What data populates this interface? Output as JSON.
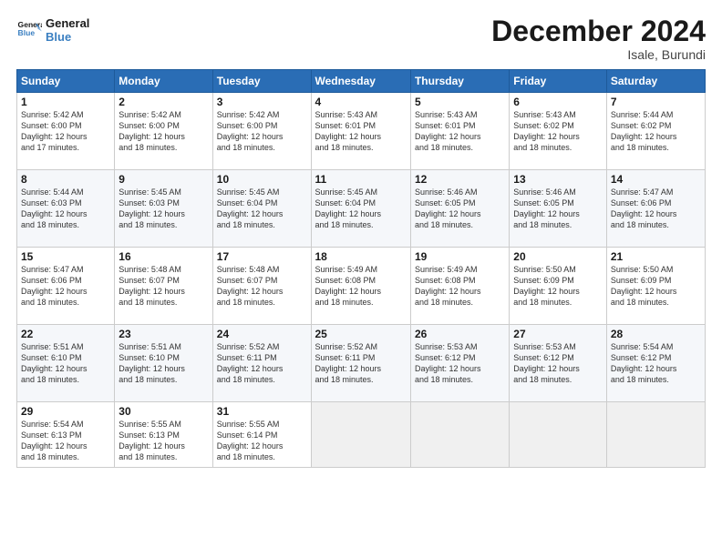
{
  "logo": {
    "line1": "General",
    "line2": "Blue"
  },
  "title": "December 2024",
  "location": "Isale, Burundi",
  "days_of_week": [
    "Sunday",
    "Monday",
    "Tuesday",
    "Wednesday",
    "Thursday",
    "Friday",
    "Saturday"
  ],
  "weeks": [
    [
      {
        "day": "1",
        "rise": "5:42 AM",
        "set": "6:00 PM",
        "daylight": "12 hours and 17 minutes."
      },
      {
        "day": "2",
        "rise": "5:42 AM",
        "set": "6:00 PM",
        "daylight": "12 hours and 18 minutes."
      },
      {
        "day": "3",
        "rise": "5:42 AM",
        "set": "6:00 PM",
        "daylight": "12 hours and 18 minutes."
      },
      {
        "day": "4",
        "rise": "5:43 AM",
        "set": "6:01 PM",
        "daylight": "12 hours and 18 minutes."
      },
      {
        "day": "5",
        "rise": "5:43 AM",
        "set": "6:01 PM",
        "daylight": "12 hours and 18 minutes."
      },
      {
        "day": "6",
        "rise": "5:43 AM",
        "set": "6:02 PM",
        "daylight": "12 hours and 18 minutes."
      },
      {
        "day": "7",
        "rise": "5:44 AM",
        "set": "6:02 PM",
        "daylight": "12 hours and 18 minutes."
      }
    ],
    [
      {
        "day": "8",
        "rise": "5:44 AM",
        "set": "6:03 PM",
        "daylight": "12 hours and 18 minutes."
      },
      {
        "day": "9",
        "rise": "5:45 AM",
        "set": "6:03 PM",
        "daylight": "12 hours and 18 minutes."
      },
      {
        "day": "10",
        "rise": "5:45 AM",
        "set": "6:04 PM",
        "daylight": "12 hours and 18 minutes."
      },
      {
        "day": "11",
        "rise": "5:45 AM",
        "set": "6:04 PM",
        "daylight": "12 hours and 18 minutes."
      },
      {
        "day": "12",
        "rise": "5:46 AM",
        "set": "6:05 PM",
        "daylight": "12 hours and 18 minutes."
      },
      {
        "day": "13",
        "rise": "5:46 AM",
        "set": "6:05 PM",
        "daylight": "12 hours and 18 minutes."
      },
      {
        "day": "14",
        "rise": "5:47 AM",
        "set": "6:06 PM",
        "daylight": "12 hours and 18 minutes."
      }
    ],
    [
      {
        "day": "15",
        "rise": "5:47 AM",
        "set": "6:06 PM",
        "daylight": "12 hours and 18 minutes."
      },
      {
        "day": "16",
        "rise": "5:48 AM",
        "set": "6:07 PM",
        "daylight": "12 hours and 18 minutes."
      },
      {
        "day": "17",
        "rise": "5:48 AM",
        "set": "6:07 PM",
        "daylight": "12 hours and 18 minutes."
      },
      {
        "day": "18",
        "rise": "5:49 AM",
        "set": "6:08 PM",
        "daylight": "12 hours and 18 minutes."
      },
      {
        "day": "19",
        "rise": "5:49 AM",
        "set": "6:08 PM",
        "daylight": "12 hours and 18 minutes."
      },
      {
        "day": "20",
        "rise": "5:50 AM",
        "set": "6:09 PM",
        "daylight": "12 hours and 18 minutes."
      },
      {
        "day": "21",
        "rise": "5:50 AM",
        "set": "6:09 PM",
        "daylight": "12 hours and 18 minutes."
      }
    ],
    [
      {
        "day": "22",
        "rise": "5:51 AM",
        "set": "6:10 PM",
        "daylight": "12 hours and 18 minutes."
      },
      {
        "day": "23",
        "rise": "5:51 AM",
        "set": "6:10 PM",
        "daylight": "12 hours and 18 minutes."
      },
      {
        "day": "24",
        "rise": "5:52 AM",
        "set": "6:11 PM",
        "daylight": "12 hours and 18 minutes."
      },
      {
        "day": "25",
        "rise": "5:52 AM",
        "set": "6:11 PM",
        "daylight": "12 hours and 18 minutes."
      },
      {
        "day": "26",
        "rise": "5:53 AM",
        "set": "6:12 PM",
        "daylight": "12 hours and 18 minutes."
      },
      {
        "day": "27",
        "rise": "5:53 AM",
        "set": "6:12 PM",
        "daylight": "12 hours and 18 minutes."
      },
      {
        "day": "28",
        "rise": "5:54 AM",
        "set": "6:12 PM",
        "daylight": "12 hours and 18 minutes."
      }
    ],
    [
      {
        "day": "29",
        "rise": "5:54 AM",
        "set": "6:13 PM",
        "daylight": "12 hours and 18 minutes."
      },
      {
        "day": "30",
        "rise": "5:55 AM",
        "set": "6:13 PM",
        "daylight": "12 hours and 18 minutes."
      },
      {
        "day": "31",
        "rise": "5:55 AM",
        "set": "6:14 PM",
        "daylight": "12 hours and 18 minutes."
      },
      null,
      null,
      null,
      null
    ]
  ]
}
